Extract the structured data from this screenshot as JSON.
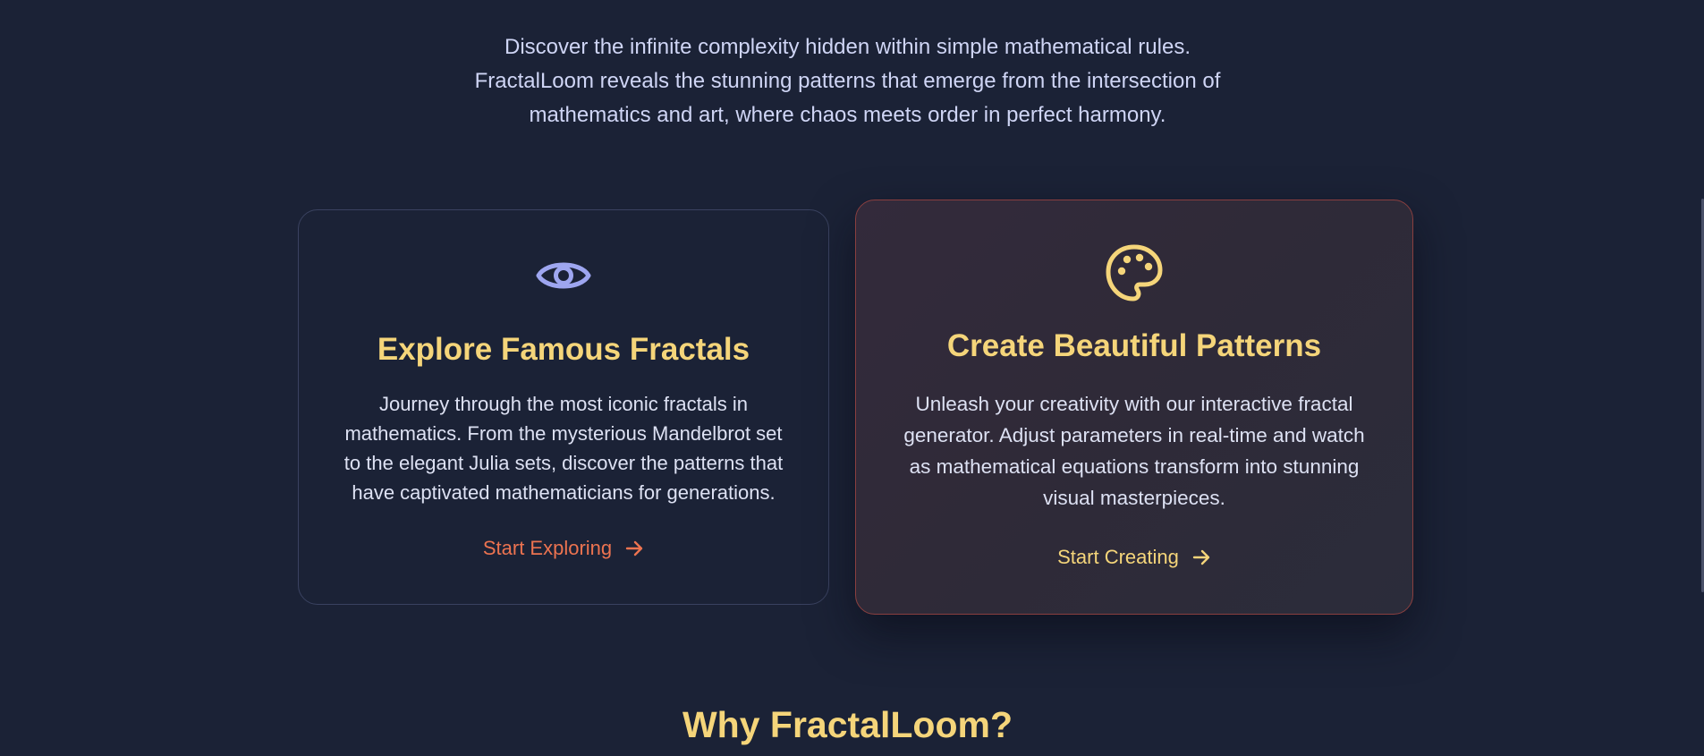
{
  "intro": {
    "line1": "Discover the infinite complexity hidden within simple mathematical rules.",
    "line2": "FractalLoom reveals the stunning patterns that emerge from the intersection of",
    "line3": "mathematics and art, where chaos meets order in perfect harmony."
  },
  "cards": {
    "explore": {
      "icon": "eye-icon",
      "title": "Explore Famous Fractals",
      "description": "Journey through the most iconic fractals in mathematics. From the mysterious Mandelbrot set to the elegant Julia sets, discover the patterns that have captivated mathematicians for generations.",
      "cta": "Start Exploring",
      "accent_color": "#ec7350",
      "icon_color": "#9ea6f0"
    },
    "create": {
      "icon": "palette-icon",
      "title": "Create Beautiful Patterns",
      "description": "Unleash your creativity with our interactive fractal generator. Adjust parameters in real-time and watch as mathematical equations transform into stunning visual masterpieces.",
      "cta": "Start Creating",
      "accent_color": "#f5d57a",
      "icon_color": "#f5d57a"
    }
  },
  "why": {
    "heading": "Why FractalLoom?"
  },
  "colors": {
    "background": "#1b2236",
    "heading": "#f5d57a",
    "text": "#dde1f3"
  }
}
